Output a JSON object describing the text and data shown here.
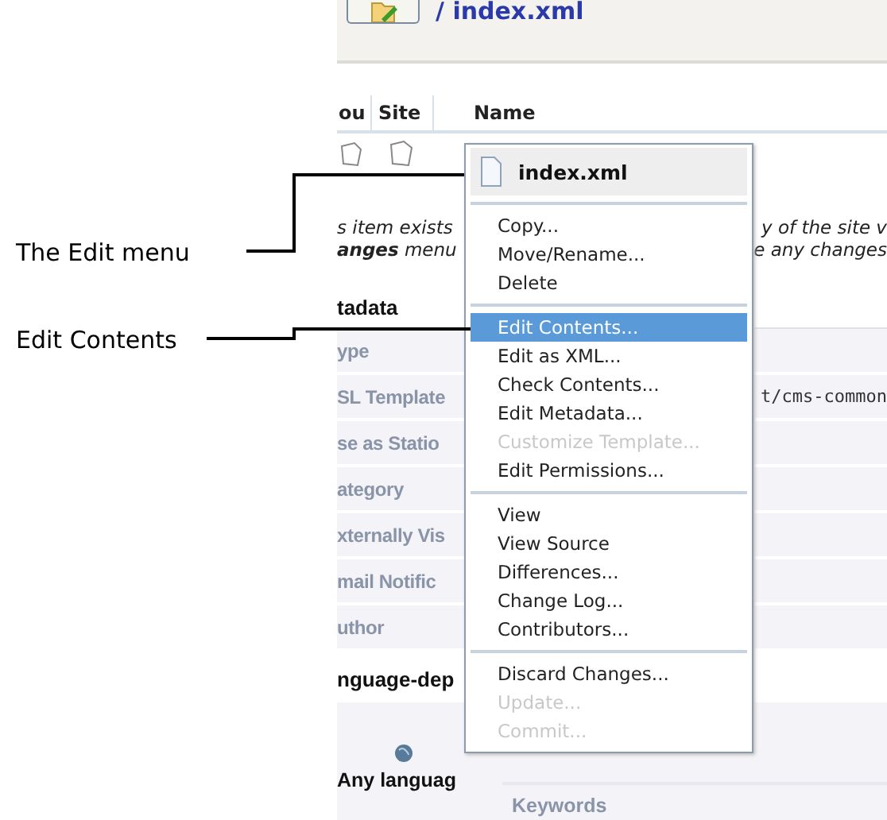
{
  "callouts": [
    {
      "label": "The Edit menu"
    },
    {
      "label": "Edit Contents"
    }
  ],
  "header": {
    "path": "/ index.xml"
  },
  "columns": [
    "ou",
    "Site",
    "Name"
  ],
  "notice": [
    {
      "left": "s item exists",
      "right": "y of the site v"
    },
    {
      "left": "**anges** menu",
      "right": "e any changes"
    }
  ],
  "metadata": {
    "heading": "tadata",
    "rows": [
      {
        "label": "ype"
      },
      {
        "label": "SL Template",
        "value": "t/cms-common"
      },
      {
        "label": "se as Statio"
      },
      {
        "label": "ategory"
      },
      {
        "label": "xternally Vis"
      },
      {
        "label": "mail Notific"
      },
      {
        "label": "uthor"
      }
    ]
  },
  "language": {
    "heading": "nguage-dep",
    "item": "Any languag",
    "fields": [
      "Keywords"
    ]
  },
  "menu": {
    "title": "index.xml",
    "groups": [
      [
        {
          "label": "Copy...",
          "disabled": false,
          "selected": false
        },
        {
          "label": "Move/Rename...",
          "disabled": false,
          "selected": false
        },
        {
          "label": "Delete",
          "disabled": false,
          "selected": false
        }
      ],
      [
        {
          "label": "Edit Contents...",
          "disabled": false,
          "selected": true
        },
        {
          "label": "Edit as XML...",
          "disabled": false,
          "selected": false
        },
        {
          "label": "Check Contents...",
          "disabled": false,
          "selected": false
        },
        {
          "label": "Edit Metadata...",
          "disabled": false,
          "selected": false
        },
        {
          "label": "Customize Template...",
          "disabled": true,
          "selected": false
        },
        {
          "label": "Edit Permissions...",
          "disabled": false,
          "selected": false
        }
      ],
      [
        {
          "label": "View",
          "disabled": false,
          "selected": false
        },
        {
          "label": "View Source",
          "disabled": false,
          "selected": false
        },
        {
          "label": "Differences...",
          "disabled": false,
          "selected": false
        },
        {
          "label": "Change Log...",
          "disabled": false,
          "selected": false
        },
        {
          "label": "Contributors...",
          "disabled": false,
          "selected": false
        }
      ],
      [
        {
          "label": "Discard Changes...",
          "disabled": false,
          "selected": false
        },
        {
          "label": "Update...",
          "disabled": true,
          "selected": false
        },
        {
          "label": "Commit...",
          "disabled": true,
          "selected": false
        }
      ]
    ]
  }
}
